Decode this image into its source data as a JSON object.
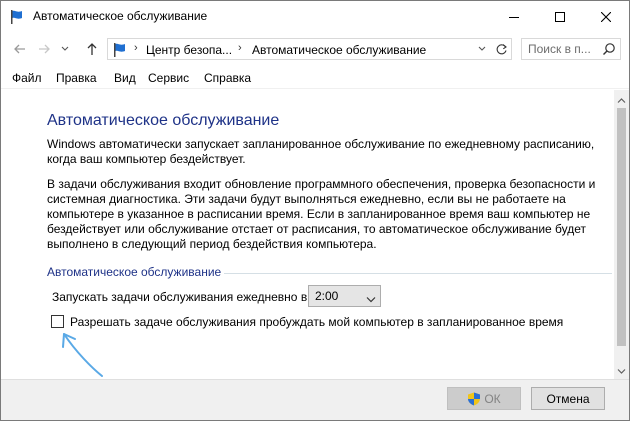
{
  "window": {
    "title": "Автоматическое обслуживание",
    "icon": "control-panel-flag-icon"
  },
  "addressbar": {
    "segments": [
      "Центр безопа...",
      "Автоматическое обслуживание"
    ],
    "search_placeholder": "Поиск в п..."
  },
  "menu": {
    "items": [
      "Файл",
      "Правка",
      "Вид",
      "Сервис",
      "Справка"
    ]
  },
  "main": {
    "title": "Автоматическое обслуживание",
    "paragraph1": "Windows автоматически запускает запланированное обслуживание по ежедневному расписанию, когда ваш компьютер бездействует.",
    "paragraph2": "В задачи обслуживания входит обновление программного обеспечения, проверка безопасности и системная диагностика. Эти задачи будут выполняться ежедневно, если вы не работаете на компьютере в указанное в расписании время. Если в запланированное время ваш компьютер не бездействует или обслуживание отстает от расписания, то автоматическое обслуживание будет выполнено в следующий период бездействия компьютера.",
    "group_label": "Автоматическое обслуживание",
    "run_label": "Запускать задачи обслуживания ежедневно в",
    "time_value": "2:00",
    "wake_label": "Разрешать задаче обслуживания пробуждать мой компьютер в запланированное время",
    "wake_checked": false
  },
  "buttons": {
    "ok": "ОК",
    "cancel": "Отмена"
  },
  "colors": {
    "heading": "#1e3287",
    "annotation_arrow": "#5aa9e6",
    "flag_blue": "#1f6fd1"
  }
}
